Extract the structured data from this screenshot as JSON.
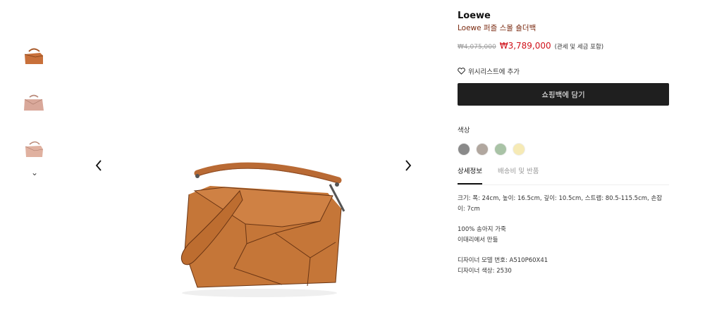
{
  "gallery": {
    "thumbnails": [
      {
        "alt": "tan-bag-thumbnail",
        "color": "#c8703a"
      },
      {
        "alt": "pink-bag-thumbnail",
        "color": "#d9a89a"
      },
      {
        "alt": "blush-bag-thumbnail",
        "color": "#e0b1a0"
      }
    ],
    "scroll_down_glyph": "⌄",
    "prev_glyph": "‹",
    "next_glyph": "›"
  },
  "product": {
    "brand": "Loewe",
    "name": "Loewe 퍼즐 스몰 숄더백",
    "old_price": "₩4,075,000",
    "new_price": "₩3,789,000",
    "tax_note": "(관세 및 세금 포함)",
    "wishlist_label": "위시리스트에 추가",
    "cart_label": "쇼핑백에 담기",
    "color_label": "색상",
    "colors": [
      "#8a8a8a",
      "#b1a79f",
      "#a9c3a6",
      "#f6eab5"
    ],
    "accent_color": "#d0121b"
  },
  "tabs": [
    {
      "label": "상세정보",
      "active": true
    },
    {
      "label": "배송비 및 반품",
      "active": false
    }
  ],
  "details": {
    "size": "크기: 폭: 24cm, 높이: 16.5cm, 깊이: 10.5cm, 스트랩: 80.5-115.5cm, 손잡이: 7cm",
    "material_1": "100% 송아지 가죽",
    "material_2": "이태리에서 만듦",
    "model_number": "디자이너 모델 번호: A510P60X41",
    "designer_color": "디자이너 색상: 2530"
  }
}
